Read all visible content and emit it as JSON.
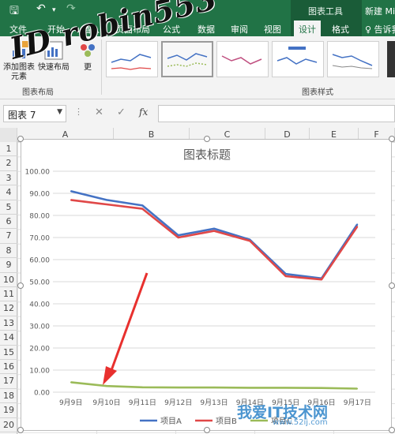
{
  "titlebar": {
    "save_icon": "save-icon",
    "undo_icon": "undo-icon",
    "redo_icon": "redo-icon",
    "context_label": "图表工具",
    "doc_title": "新建 Mic"
  },
  "ribbon_tabs": {
    "file": "文件",
    "home": "开始",
    "insert": "插入",
    "page_layout": "页面布局",
    "formulas": "公式",
    "data": "数据",
    "review": "审阅",
    "view": "视图",
    "design": "设计",
    "format": "格式",
    "tell_me": "♀ 告诉我"
  },
  "ribbon": {
    "add_element": "添加图表元素",
    "quick_layout": "快速布局",
    "change_colors": "更",
    "group_layout": "图表布局",
    "group_styles": "图表样式"
  },
  "formula_bar": {
    "name_box": "图表 7",
    "cancel": "✕",
    "enter": "✓",
    "fx": "fx",
    "value": ""
  },
  "columns": [
    "A",
    "B",
    "C",
    "D",
    "E",
    "F"
  ],
  "rows": [
    "1",
    "2",
    "3",
    "4",
    "5",
    "6",
    "7",
    "8",
    "9",
    "10",
    "11",
    "12",
    "13",
    "14",
    "15",
    "16",
    "17",
    "18",
    "19",
    "20"
  ],
  "chart_data": {
    "type": "line",
    "title": "图表标题",
    "categories": [
      "9月9日",
      "9月10日",
      "9月11日",
      "9月12日",
      "9月13日",
      "9月14日",
      "9月15日",
      "9月16日",
      "9月17日"
    ],
    "ylim": [
      0,
      100
    ],
    "yticks": [
      "0.00",
      "10.00",
      "20.00",
      "30.00",
      "40.00",
      "50.00",
      "60.00",
      "70.00",
      "80.00",
      "90.00",
      "100.00"
    ],
    "grid": true,
    "legend": "bottom",
    "series": [
      {
        "name": "项目A",
        "color": "#4472c4",
        "values": [
          91,
          87,
          84.5,
          71,
          74,
          69,
          53.5,
          51.5,
          76
        ]
      },
      {
        "name": "项目B",
        "color": "#e04848",
        "values": [
          87,
          85,
          83,
          70,
          73,
          68.5,
          52.5,
          51,
          75
        ]
      },
      {
        "name": "项目C",
        "color": "#9bbb59",
        "values": [
          4.5,
          2.8,
          2.2,
          2.1,
          2.1,
          2.0,
          2.0,
          1.9,
          1.6
        ]
      }
    ]
  },
  "watermark": {
    "top_text": "ID robin553",
    "bottom_text": "我爱IT技术网",
    "bottom_url": "www.52ij.com"
  }
}
